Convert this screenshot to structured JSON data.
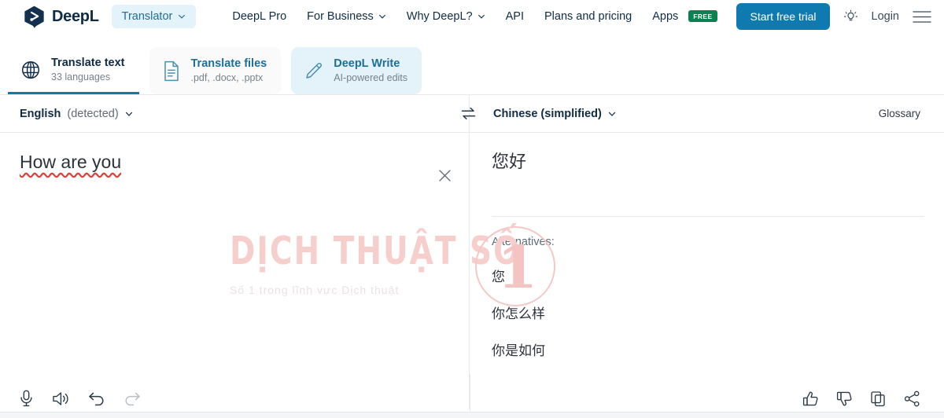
{
  "brand": {
    "name": "DeepL",
    "logo_icon": "deepl-hexagon-logo",
    "product_selector": {
      "label": "Translator",
      "icon": "chevron-down-icon"
    }
  },
  "topnav": {
    "links": [
      {
        "label": "DeepL Pro",
        "has_chevron": false
      },
      {
        "label": "For Business",
        "has_chevron": true
      },
      {
        "label": "Why DeepL?",
        "has_chevron": true
      },
      {
        "label": "API",
        "has_chevron": false
      },
      {
        "label": "Plans and pricing",
        "has_chevron": false
      },
      {
        "label": "Apps",
        "has_chevron": false,
        "badge": "FREE"
      }
    ],
    "cta_label": "Start free trial",
    "login_label": "Login",
    "theme_icon": "lightbulb-icon",
    "menu_icon": "hamburger-menu-icon",
    "cta_color": "#0f7ab0",
    "badge_color": "#0a8150",
    "accent_color": "#1e6f96"
  },
  "tabs": [
    {
      "title": "Translate text",
      "subtitle": "33 languages",
      "icon": "globe-icon",
      "state": "active"
    },
    {
      "title": "Translate files",
      "subtitle": ".pdf, .docx, .pptx",
      "icon": "document-icon",
      "state": "inactive"
    },
    {
      "title": "DeepL Write",
      "subtitle": "AI-powered edits",
      "icon": "pencil-icon",
      "state": "highlighted"
    }
  ],
  "language_bar": {
    "source_language": "English",
    "source_detected_note": "(detected)",
    "target_language": "Chinese (simplified)",
    "swap_icon": "swap-arrows-icon",
    "chevron_icon": "chevron-down-icon",
    "glossary_label": "Glossary"
  },
  "source_panel": {
    "text": "How are you",
    "clear_icon": "close-x-icon",
    "tools": [
      {
        "icon": "microphone-icon",
        "state": "enabled"
      },
      {
        "icon": "speaker-icon",
        "state": "enabled"
      },
      {
        "icon": "undo-icon",
        "state": "enabled"
      },
      {
        "icon": "redo-icon",
        "state": "disabled"
      }
    ]
  },
  "target_panel": {
    "translation": "您好",
    "alternatives_label": "Alternatives:",
    "alternatives": [
      "您",
      "你怎么样",
      "你是如何"
    ],
    "tools": [
      {
        "icon": "thumbs-up-icon"
      },
      {
        "icon": "thumbs-down-icon"
      },
      {
        "icon": "copy-icon"
      },
      {
        "icon": "share-icon"
      }
    ]
  },
  "watermark": {
    "main": "DỊCH THUẬT SỐ",
    "tagline": "Số 1 trong lĩnh vực Dịch thuật",
    "badge_number": "1",
    "color": "#f6cfcd"
  }
}
